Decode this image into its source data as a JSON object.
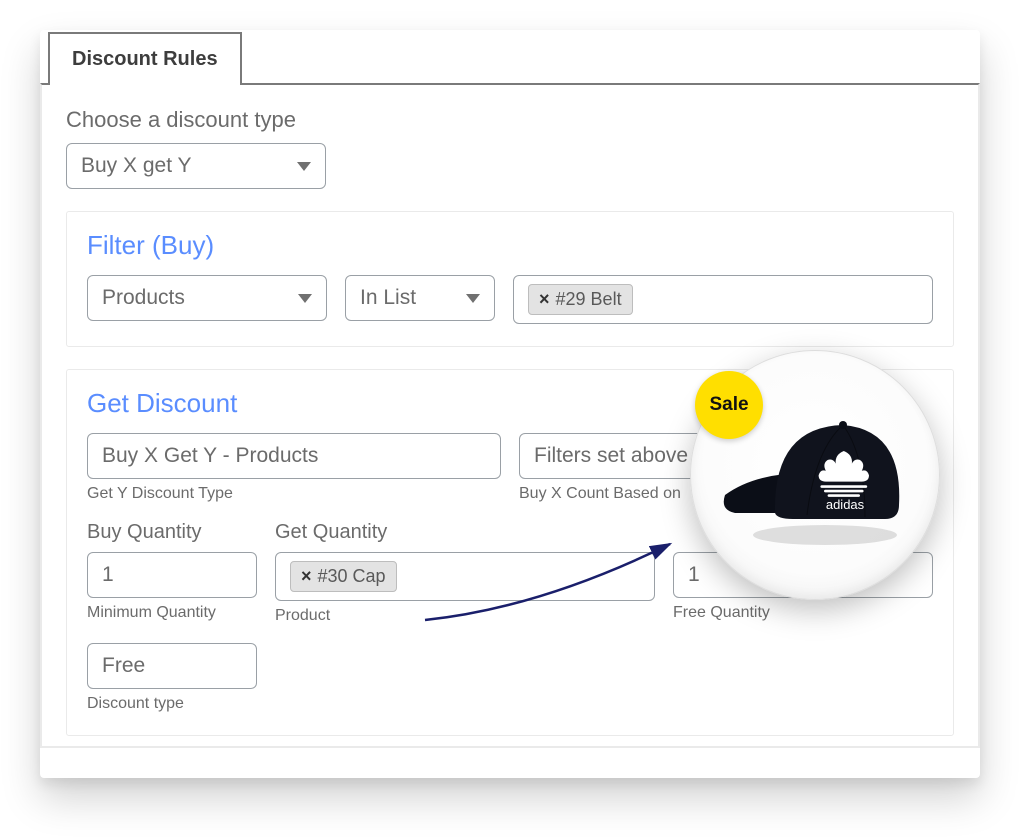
{
  "tab": {
    "label": "Discount Rules"
  },
  "discountType": {
    "label": "Choose a discount type",
    "value": "Buy X get Y"
  },
  "filter": {
    "title": "Filter (Buy)",
    "field": "Products",
    "op": "In List",
    "chip": "#29 Belt"
  },
  "getDiscount": {
    "title": "Get Discount",
    "yType": {
      "value": "Buy X Get Y - Products",
      "help": "Get Y Discount Type"
    },
    "basedOn": {
      "value": "Filters set above",
      "help": "Buy X Count Based on"
    },
    "buyQty": {
      "label": "Buy Quantity",
      "value": "1",
      "help": "Minimum Quantity"
    },
    "getQty": {
      "label": "Get Quantity",
      "chip": "#30 Cap",
      "help": "Product"
    },
    "freeQty": {
      "value": "1",
      "help": "Free Quantity"
    },
    "discType": {
      "value": "Free",
      "help": "Discount type"
    }
  },
  "bubble": {
    "badge": "Sale",
    "brand": "adidas"
  }
}
